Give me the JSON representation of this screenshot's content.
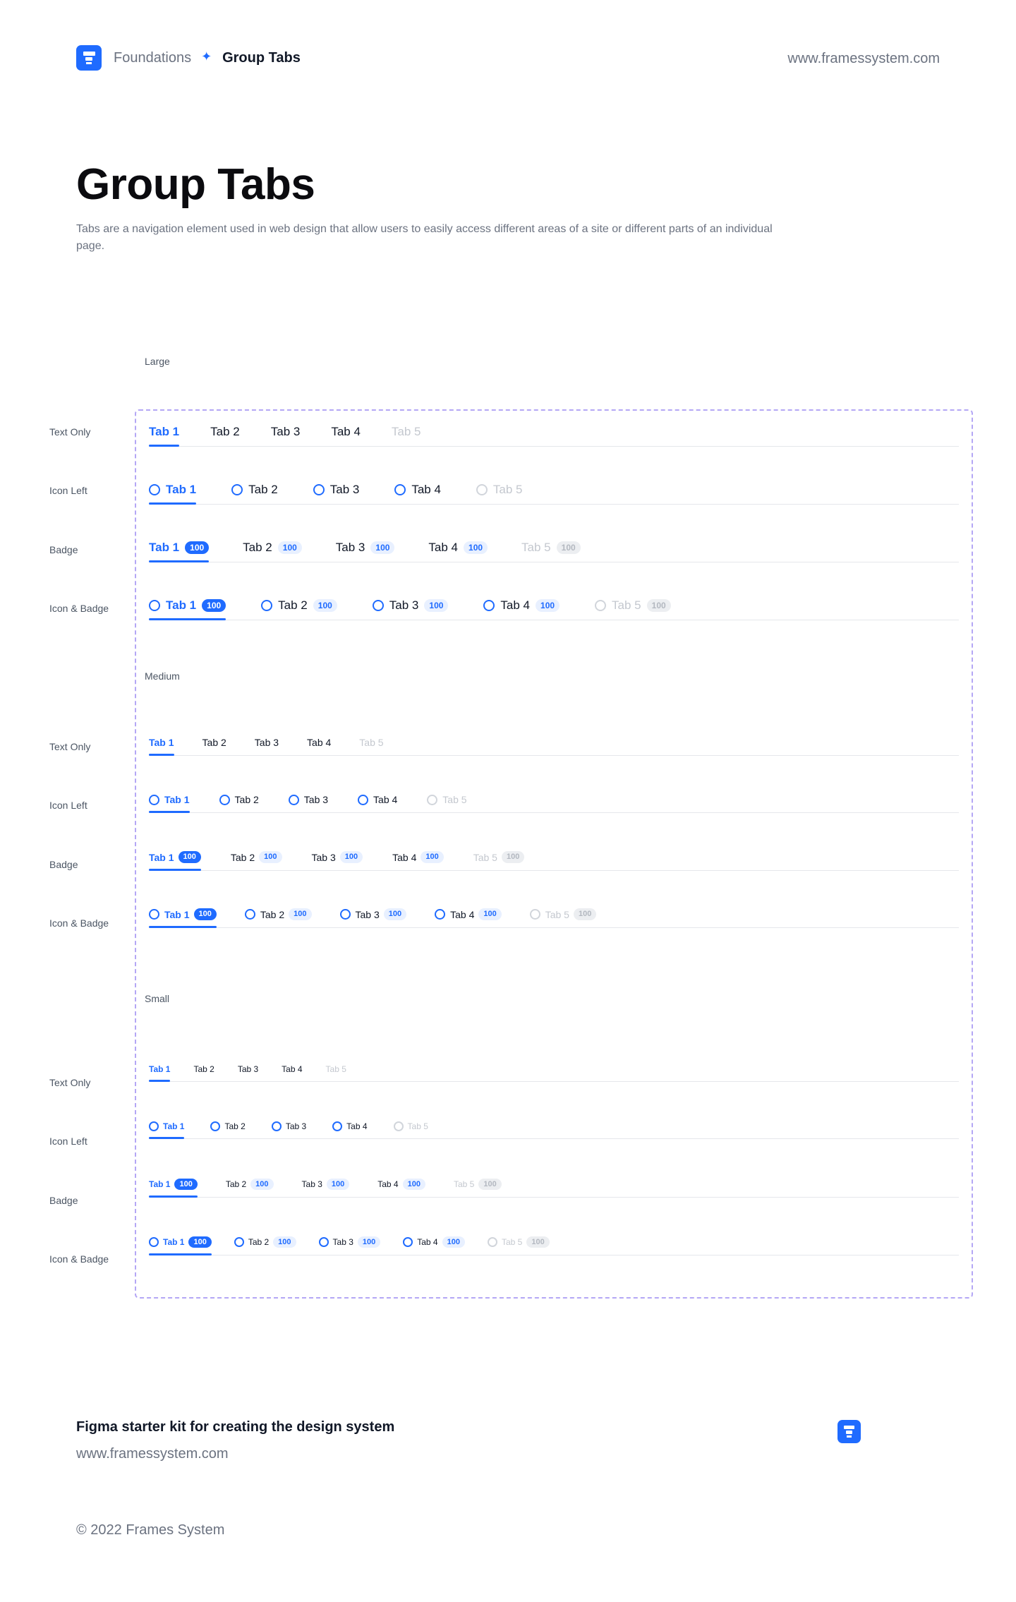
{
  "header": {
    "breadcrumb_parent": "Foundations",
    "breadcrumb_current": "Group Tabs",
    "site_url": "www.framessystem.com"
  },
  "page": {
    "title": "Group Tabs",
    "description": "Tabs are a navigation element used in web design that allow users to easily access different areas of a site or different parts of an individual page."
  },
  "row_labels": {
    "text_only": "Text Only",
    "icon_left": "Icon Left",
    "badge": "Badge",
    "icon_badge": "Icon & Badge"
  },
  "tabs": [
    "Tab 1",
    "Tab 2",
    "Tab 3",
    "Tab 4",
    "Tab 5"
  ],
  "badge_value": "100",
  "sizes": [
    {
      "label": "Large"
    },
    {
      "label": "Medium"
    },
    {
      "label": "Small"
    }
  ],
  "footer": {
    "title": "Figma starter kit for creating the design system",
    "url": "www.framessystem.com",
    "copyright": "© 2022 Frames System"
  },
  "colors": {
    "accent": "#1f6bff",
    "frame_border": "#b4a7f5",
    "disabled_text": "#c4c8cf",
    "badge_bg": "#e8f0ff"
  }
}
